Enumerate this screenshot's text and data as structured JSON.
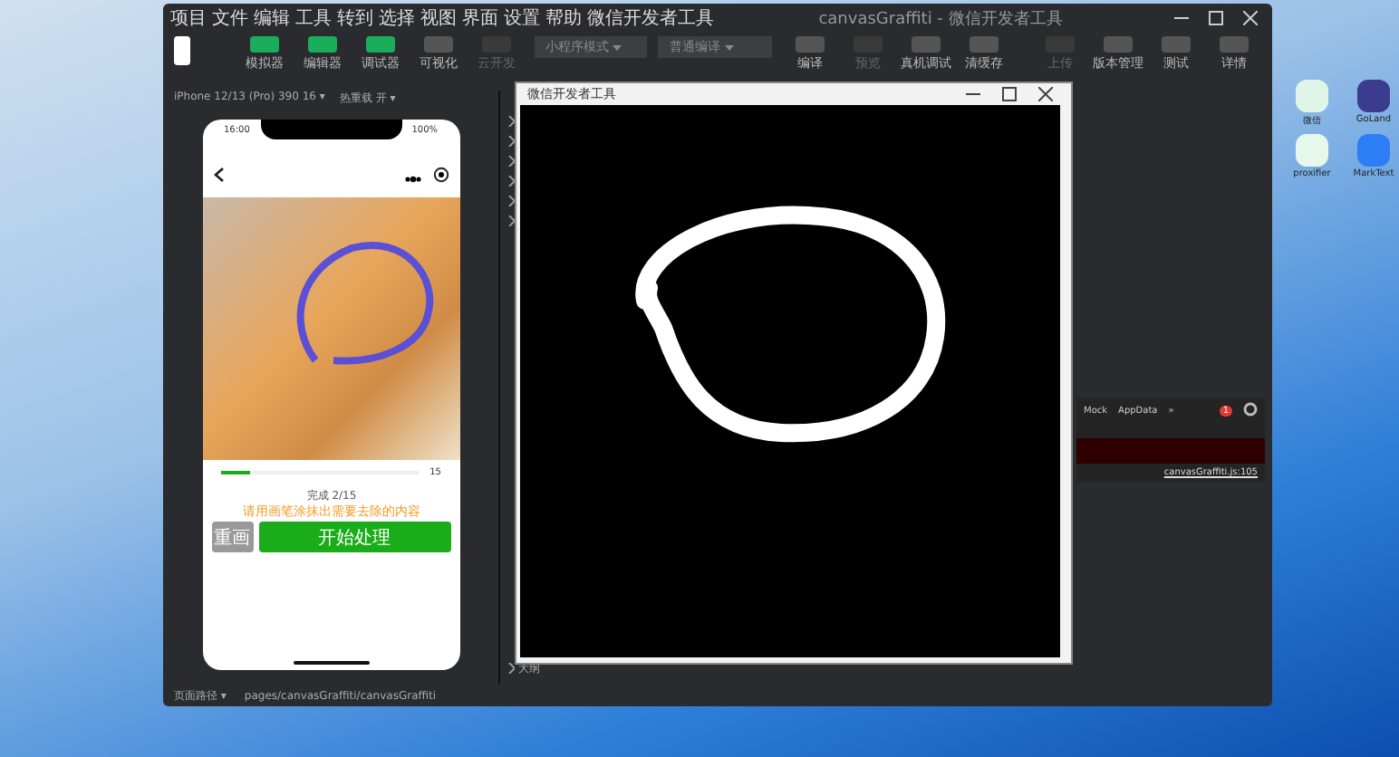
{
  "main_window": {
    "menu": [
      "项目",
      "文件",
      "编辑",
      "工具",
      "转到",
      "选择",
      "视图",
      "界面",
      "设置",
      "帮助",
      "微信开发者工具"
    ],
    "title": "canvasGraffiti - 微信开发者工具",
    "toolbar_left": [
      {
        "label": "模拟器",
        "kind": "green"
      },
      {
        "label": "编辑器",
        "kind": "green"
      },
      {
        "label": "调试器",
        "kind": "green"
      },
      {
        "label": "可视化",
        "kind": "grey"
      },
      {
        "label": "云开发",
        "kind": "disabled"
      }
    ],
    "dropdowns": [
      "小程序模式",
      "普通编译"
    ],
    "toolbar_mid": [
      {
        "label": "编译",
        "kind": "refresh"
      },
      {
        "label": "预览",
        "kind": "disabled"
      },
      {
        "label": "真机调试",
        "kind": "grey"
      },
      {
        "label": "清缓存",
        "kind": "grey"
      }
    ],
    "toolbar_right": [
      {
        "label": "上传",
        "kind": "disabled"
      },
      {
        "label": "版本管理",
        "kind": "grey"
      },
      {
        "label": "测试",
        "kind": "grey"
      },
      {
        "label": "详情",
        "kind": "grey"
      }
    ],
    "device": "iPhone 12/13 (Pro) 390 16 ▾",
    "zoom": "热重载 开 ▾",
    "phone": {
      "time": "16:00",
      "battery": "100%",
      "progress": {
        "level": 0.15
      },
      "count": "15",
      "status": "完成 2/15",
      "hint": "请用画笔涂抹出需要去除的内容",
      "buttons": [
        {
          "label": "重画",
          "kind": "secondary"
        },
        {
          "label": "开始处理",
          "kind": "primary"
        }
      ]
    },
    "devtools": {
      "tabs": [
        "Mock",
        "AppData",
        "»"
      ],
      "errors": "1",
      "link": "canvasGraffiti.js:105"
    },
    "outline": "大纲",
    "status_bar": {
      "path_label": "页面路径 ▾",
      "path": "pages/canvasGraffiti/canvasGraffiti"
    }
  },
  "popup": {
    "title": "微信开发者工具"
  },
  "desktop_icons": [
    {
      "label": "微信",
      "kind": "chat"
    },
    {
      "label": "GoLand",
      "kind": "app"
    },
    {
      "label": "proxifier",
      "kind": "sheet"
    },
    {
      "label": "MarkText",
      "kind": "note"
    }
  ]
}
